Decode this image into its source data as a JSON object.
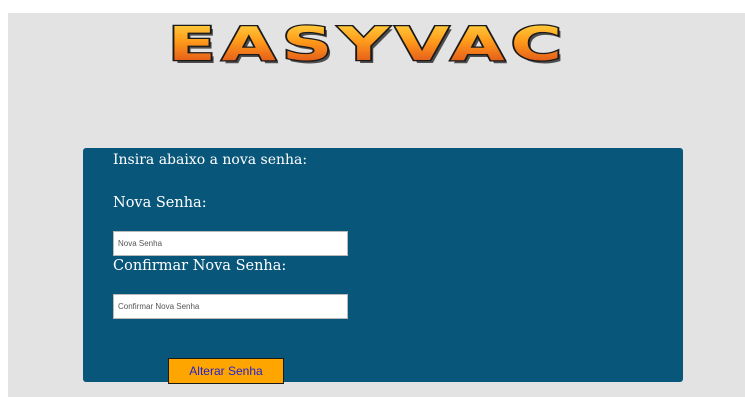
{
  "logo": {
    "text": "EASYVAC"
  },
  "form": {
    "intro": "Insira abaixo a nova senha:",
    "new_password": {
      "label": "Nova Senha:",
      "placeholder": "Nova Senha",
      "value": ""
    },
    "confirm_password": {
      "label": "Confirmar Nova Senha:",
      "placeholder": "Confirmar Nova Senha",
      "value": ""
    },
    "submit_label": "Alterar Senha"
  },
  "colors": {
    "page_background": "#e3e3e3",
    "card_background": "#08567a",
    "button_background": "#ffa500",
    "button_text": "#1f1fd6",
    "logo_fill_top": "#ffd020",
    "logo_fill_bottom": "#e8501a"
  }
}
